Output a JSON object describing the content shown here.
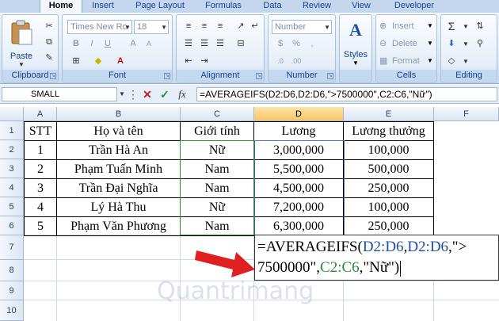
{
  "ribbon": {
    "tabs": [
      "Home",
      "Insert",
      "Page Layout",
      "Formulas",
      "Data",
      "Review",
      "View",
      "Developer"
    ],
    "clipboard": {
      "paste_label": "Paste",
      "label": "Clipboard"
    },
    "font": {
      "name": "Times New Ro",
      "size": "18",
      "label": "Font"
    },
    "alignment": {
      "label": "Alignment"
    },
    "number": {
      "format": "Number",
      "label": "Number"
    },
    "styles": {
      "label": "Styles"
    },
    "cells": {
      "insert": "Insert",
      "delete": "Delete",
      "format": "Format",
      "label": "Cells"
    },
    "editing": {
      "sum": "Σ",
      "label": "Editing"
    }
  },
  "formula_bar": {
    "name_box": "SMALL",
    "fx": "fx",
    "formula": "=AVERAGEIFS(D2:D6,D2:D6,\">7500000\",C2:C6,\"Nữ\")"
  },
  "sheet": {
    "columns": [
      "A",
      "B",
      "C",
      "D",
      "E",
      "F"
    ],
    "rows": [
      "1",
      "2",
      "3",
      "4",
      "5",
      "6",
      "7",
      "8",
      "9",
      "10"
    ],
    "headers": [
      "STT",
      "Họ và tên",
      "Giới tính",
      "Lương",
      "Lương thưởng"
    ],
    "data": [
      [
        "1",
        "Trần Hà An",
        "Nữ",
        "3,000,000",
        "100,000"
      ],
      [
        "2",
        "Phạm Tuấn Minh",
        "Nam",
        "5,500,000",
        "500,000"
      ],
      [
        "3",
        "Trần Đại Nghĩa",
        "Nam",
        "4,500,000",
        "250,000"
      ],
      [
        "4",
        "Lý Hà Thu",
        "Nữ",
        "7,200,000",
        "100,000"
      ],
      [
        "5",
        "Phạm Văn Phương",
        "Nam",
        "6,300,000",
        "250,000"
      ]
    ],
    "edit": {
      "p1": "=AVERAGEIFS(",
      "p2": "D2:D6",
      "p3": ",",
      "p4": "D2:D6",
      "p5": ",\">",
      "p6": "7500000\",",
      "p7": "C2:C6",
      "p8": ",\"Nữ\")"
    }
  },
  "watermark": "Quantrimang",
  "colors": {
    "accent": "#15428b",
    "arrow": "#e02020"
  }
}
